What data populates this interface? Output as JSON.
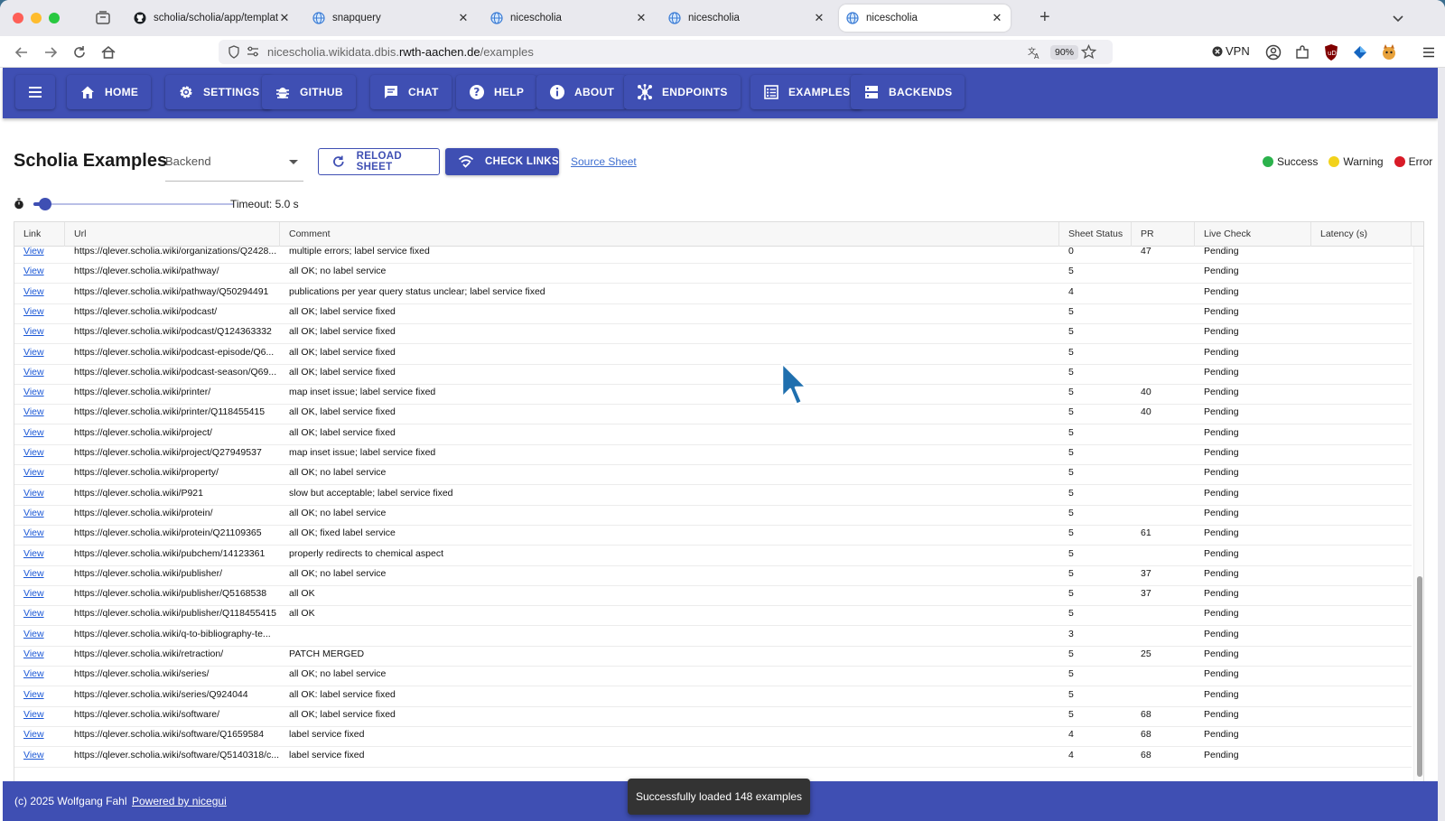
{
  "browser": {
    "tabs": [
      {
        "label": "scholia/scholia/app/templates/a",
        "icon": "github-icon",
        "active": false
      },
      {
        "label": "snapquery",
        "icon": "globe-icon",
        "active": false
      },
      {
        "label": "nicescholia",
        "icon": "globe-icon",
        "active": false
      },
      {
        "label": "nicescholia",
        "icon": "globe-icon",
        "active": false
      },
      {
        "label": "nicescholia",
        "icon": "globe-icon",
        "active": true
      }
    ],
    "url_prefix": "nicescholia.wikidata.dbis.",
    "url_host": "rwth-aachen.de",
    "url_path": "/examples",
    "zoom": "90%",
    "vpn_label": "VPN"
  },
  "header": {
    "menu_icon": "menu-icon",
    "buttons": [
      {
        "label": "HOME",
        "icon": "home-icon"
      },
      {
        "label": "SETTINGS",
        "icon": "gear-icon"
      },
      {
        "label": "GITHUB",
        "icon": "bug-icon"
      },
      {
        "label": "CHAT",
        "icon": "chat-icon"
      },
      {
        "label": "HELP",
        "icon": "help-icon"
      },
      {
        "label": "ABOUT",
        "icon": "info-icon"
      },
      {
        "label": "ENDPOINTS",
        "icon": "hub-icon"
      },
      {
        "label": "EXAMPLES",
        "icon": "list-icon"
      },
      {
        "label": "BACKENDS",
        "icon": "server-icon"
      }
    ],
    "accent": "#3f4fb3"
  },
  "toolbar": {
    "title": "Scholia Examples",
    "backend_label": "Backend",
    "reload_label": "RELOAD SHEET",
    "check_label": "CHECK LINKS",
    "source_link": "Source Sheet",
    "legend": [
      {
        "label": "Success",
        "color": "#2bb24c"
      },
      {
        "label": "Warning",
        "color": "#f2d21b"
      },
      {
        "label": "Error",
        "color": "#d81b27"
      }
    ],
    "timeout_label": "Timeout: 5.0 s",
    "timeout_fraction": 0.06
  },
  "table": {
    "columns": [
      "Link",
      "Url",
      "Comment",
      "Sheet Status",
      "PR",
      "Live Check",
      "Latency (s)"
    ],
    "rows": [
      [
        "View",
        "https://qlever.scholia.wiki/organizations/Q2428...",
        "multiple errors; label service fixed",
        "0",
        "47",
        "Pending",
        ""
      ],
      [
        "View",
        "https://qlever.scholia.wiki/pathway/",
        "all OK; no label service",
        "5",
        "",
        "Pending",
        ""
      ],
      [
        "View",
        "https://qlever.scholia.wiki/pathway/Q50294491",
        "publications per year query status unclear; label service fixed",
        "4",
        "",
        "Pending",
        ""
      ],
      [
        "View",
        "https://qlever.scholia.wiki/podcast/",
        "all OK; label service fixed",
        "5",
        "",
        "Pending",
        ""
      ],
      [
        "View",
        "https://qlever.scholia.wiki/podcast/Q124363332",
        "all OK; label service fixed",
        "5",
        "",
        "Pending",
        ""
      ],
      [
        "View",
        "https://qlever.scholia.wiki/podcast-episode/Q6...",
        "all OK; label service fixed",
        "5",
        "",
        "Pending",
        ""
      ],
      [
        "View",
        "https://qlever.scholia.wiki/podcast-season/Q69...",
        "all OK; label service fixed",
        "5",
        "",
        "Pending",
        ""
      ],
      [
        "View",
        "https://qlever.scholia.wiki/printer/",
        "map inset issue; label service fixed",
        "5",
        "40",
        "Pending",
        ""
      ],
      [
        "View",
        "https://qlever.scholia.wiki/printer/Q118455415",
        "all OK, label service fixed",
        "5",
        "40",
        "Pending",
        ""
      ],
      [
        "View",
        "https://qlever.scholia.wiki/project/",
        "all OK; label service fixed",
        "5",
        "",
        "Pending",
        ""
      ],
      [
        "View",
        "https://qlever.scholia.wiki/project/Q27949537",
        "map inset issue; label service fixed",
        "5",
        "",
        "Pending",
        ""
      ],
      [
        "View",
        "https://qlever.scholia.wiki/property/",
        "all OK; no label service",
        "5",
        "",
        "Pending",
        ""
      ],
      [
        "View",
        "https://qlever.scholia.wiki/P921",
        "slow but acceptable; label service fixed",
        "5",
        "",
        "Pending",
        ""
      ],
      [
        "View",
        "https://qlever.scholia.wiki/protein/",
        "all OK; no label service",
        "5",
        "",
        "Pending",
        ""
      ],
      [
        "View",
        "https://qlever.scholia.wiki/protein/Q21109365",
        "all OK; fixed label service",
        "5",
        "61",
        "Pending",
        ""
      ],
      [
        "View",
        "https://qlever.scholia.wiki/pubchem/14123361",
        "properly redirects to chemical aspect",
        "5",
        "",
        "Pending",
        ""
      ],
      [
        "View",
        "https://qlever.scholia.wiki/publisher/",
        "all OK; no label service",
        "5",
        "37",
        "Pending",
        ""
      ],
      [
        "View",
        "https://qlever.scholia.wiki/publisher/Q5168538",
        "all OK",
        "5",
        "37",
        "Pending",
        ""
      ],
      [
        "View",
        "https://qlever.scholia.wiki/publisher/Q118455415",
        "all OK",
        "5",
        "",
        "Pending",
        ""
      ],
      [
        "View",
        "https://qlever.scholia.wiki/q-to-bibliography-te...",
        "",
        "3",
        "",
        "Pending",
        ""
      ],
      [
        "View",
        "https://qlever.scholia.wiki/retraction/",
        "PATCH MERGED",
        "5",
        "25",
        "Pending",
        ""
      ],
      [
        "View",
        "https://qlever.scholia.wiki/series/",
        "all OK; no label service",
        "5",
        "",
        "Pending",
        ""
      ],
      [
        "View",
        "https://qlever.scholia.wiki/series/Q924044",
        "all OK: label service fixed",
        "5",
        "",
        "Pending",
        ""
      ],
      [
        "View",
        "https://qlever.scholia.wiki/software/",
        "all OK; label service fixed",
        "5",
        "68",
        "Pending",
        ""
      ],
      [
        "View",
        "https://qlever.scholia.wiki/software/Q1659584",
        "label service fixed",
        "4",
        "68",
        "Pending",
        ""
      ],
      [
        "View",
        "https://qlever.scholia.wiki/software/Q5140318/c...",
        "label service fixed",
        "4",
        "68",
        "Pending",
        ""
      ]
    ]
  },
  "footer": {
    "copyright": "(c) 2025 Wolfgang Fahl",
    "powered": "Powered by nicegui"
  },
  "toast": "Successfully loaded 148 examples"
}
